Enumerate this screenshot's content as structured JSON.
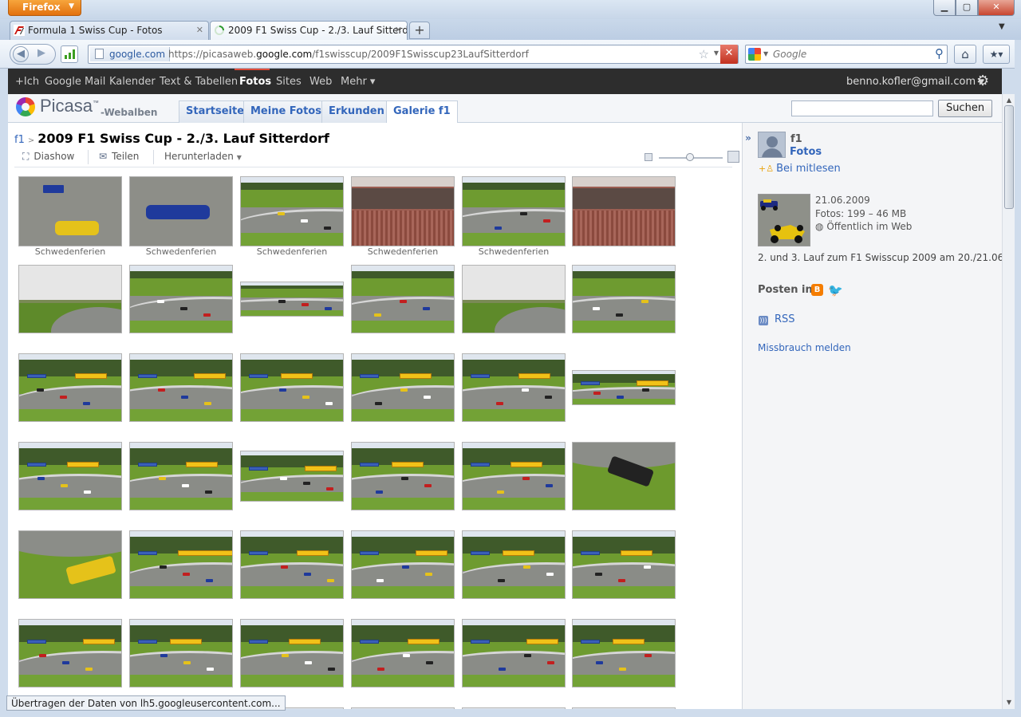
{
  "browser": {
    "app_button": "Firefox",
    "tabs": [
      {
        "title": "Formula 1 Swiss Cup - Fotos"
      },
      {
        "title": "2009 F1 Swiss Cup - 2./3. Lauf Sitterd..."
      }
    ],
    "site_identity": "google.com",
    "url_prefix": "https://picasaweb.",
    "url_domain": "google.com",
    "url_path": "/f1swisscup/2009F1Swisscup23LaufSitterdorf",
    "search_placeholder": "Google"
  },
  "google_bar": {
    "items": [
      {
        "label": "+Ich"
      },
      {
        "label": "Google Mail"
      },
      {
        "label": "Kalender"
      },
      {
        "label": "Text & Tabellen"
      },
      {
        "label": "Fotos",
        "active": true
      },
      {
        "label": "Sites"
      },
      {
        "label": "Web"
      },
      {
        "label": "Mehr ▾"
      }
    ],
    "user": "benno.kofler@gmail.com ▾"
  },
  "picasa": {
    "logo_text": "Picasa",
    "logo_tm": "™",
    "subtitle": "-Webalben",
    "tabs": [
      {
        "label": "Startseite"
      },
      {
        "label": "Meine Fotos"
      },
      {
        "label": "Erkunden"
      },
      {
        "label": "Galerie f1",
        "active": true
      }
    ],
    "search_button": "Suchen"
  },
  "album": {
    "breadcrumb_owner": "f1",
    "breadcrumb_sep": ">",
    "title": "2009 F1 Swiss Cup - 2./3. Lauf Sitterdorf",
    "toolbar": {
      "slideshow": "Diashow",
      "share": "Teilen",
      "download": "Herunterladen"
    },
    "captions": [
      "Schwedenferien",
      "Schwedenferien",
      "Schwedenferien",
      "Schwedenferien",
      "Schwedenferien"
    ]
  },
  "sidebar": {
    "owner_name": "f1",
    "owner_link": "Fotos",
    "follow": "Bei mitlesen",
    "date": "21.06.2009",
    "photo_count": "Fotos: 199 – 46 MB",
    "visibility": "Öffentlich im Web",
    "description": "2. und 3. Lauf zum F1 Swisscup 2009 am 20./21.06.",
    "post_in": "Posten in:",
    "rss": "RSS",
    "report_abuse": "Missbrauch melden"
  },
  "status_text": "Übertragen der Daten von lh5.googleusercontent.com...",
  "colors": {
    "link": "#3366bb",
    "google_bar": "#2d2d2d",
    "active_indicator": "#dd4b39"
  }
}
